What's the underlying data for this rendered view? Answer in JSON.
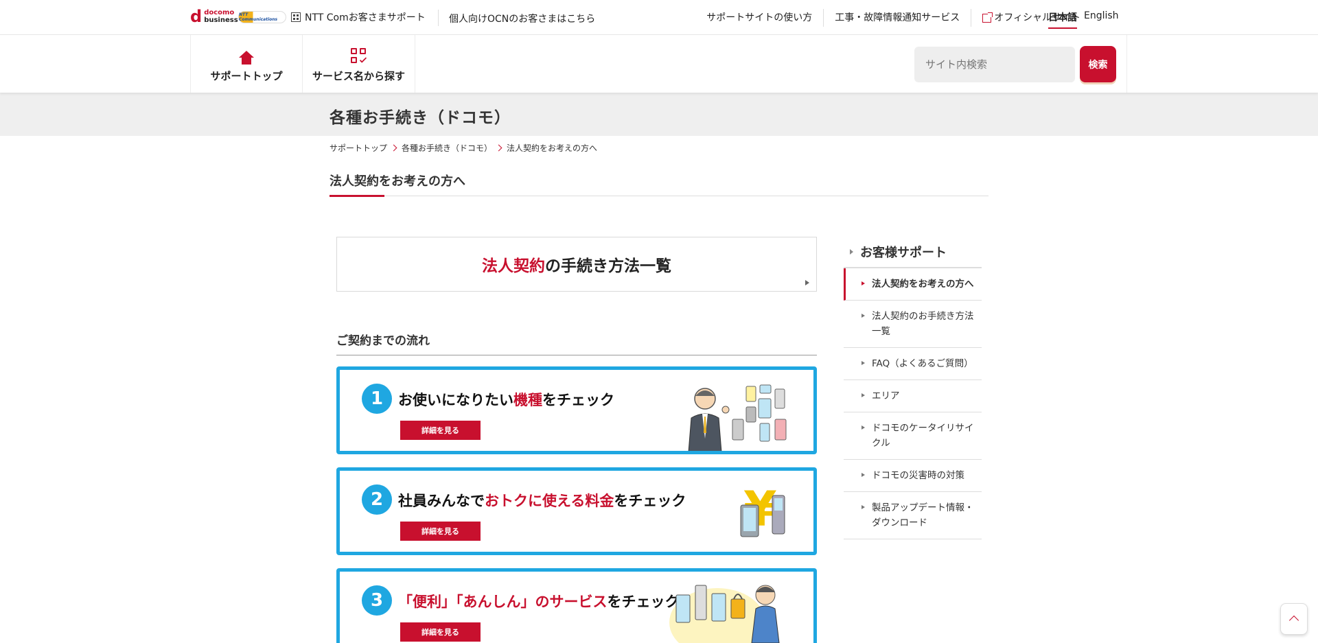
{
  "topbar": {
    "logo_docomo_1": "docomo",
    "logo_docomo_2": "business",
    "logo_ntt": "NTT Communications",
    "support_link": "NTT Comお客さまサポート",
    "ocn_link": "個人向けOCNのお客さまはこちら",
    "nav": [
      "サポートサイトの使い方",
      "工事・故障情報通知サービス",
      "オフィシャルサイト"
    ],
    "lang_ja": "日本語",
    "lang_en": "English"
  },
  "mainnav": {
    "support_top": "サポートトップ",
    "find_by_service": "サービス名から探す",
    "search_placeholder": "サイト内検索",
    "search_button": "検索"
  },
  "page": {
    "title": "各種お手続き（ドコモ）",
    "breadcrumb": [
      "サポートトップ",
      "各種お手続き（ドコモ）",
      "法人契約をお考えの方へ"
    ],
    "section_title": "法人契約をお考えの方へ",
    "list_link_accent": "法人契約",
    "list_link_rest": "の手続き方法一覧",
    "flow_heading": "ご契約までの流れ"
  },
  "steps": [
    {
      "num": "1",
      "t1": "お使いになりたい",
      "t2": "機種",
      "t3": "をチェック",
      "more": "詳細を見る"
    },
    {
      "num": "2",
      "t1": "社員みんなで",
      "t2": "おトクに使える料金",
      "t3": "をチェック",
      "more": "詳細を見る"
    },
    {
      "num": "3",
      "t1": "「便利」「あんしん」のサービス",
      "t2": "",
      "t3": "をチェック",
      "more": "詳細を見る"
    }
  ],
  "sidebar": {
    "title": "お客様サポート",
    "items": [
      "法人契約をお考えの方へ",
      "法人契約のお手続き方法一覧",
      "FAQ（よくあるご質問）",
      "エリア",
      "ドコモのケータイリサイクル",
      "ドコモの災害時の対策",
      "製品アップデート情報・ダウンロード"
    ]
  },
  "colors": {
    "accent": "#c8102e",
    "step_border": "#1fa7e1"
  },
  "icons": {
    "home": "home-icon",
    "services": "grid-check-icon",
    "external": "external-link-icon",
    "to_top": "chevron-up-icon"
  }
}
